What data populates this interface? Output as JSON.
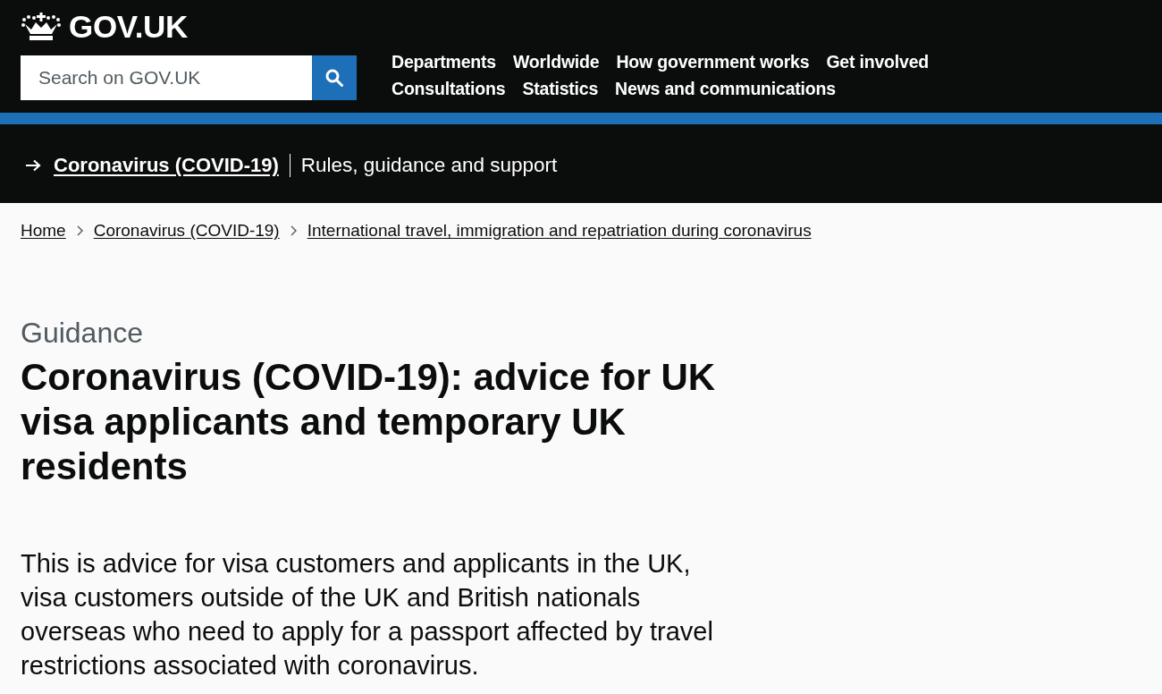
{
  "header": {
    "logo": {
      "text": "GOV.UK"
    },
    "search": {
      "placeholder": "Search on GOV.UK"
    },
    "nav": [
      "Departments",
      "Worldwide",
      "How government works",
      "Get involved",
      "Consultations",
      "Statistics",
      "News and communications"
    ]
  },
  "banner": {
    "link": "Coronavirus (COVID-19)",
    "text": "Rules, guidance and support"
  },
  "breadcrumbs": [
    "Home",
    "Coronavirus (COVID-19)",
    "International travel, immigration and repatriation during coronavirus"
  ],
  "caption": "Guidance",
  "title": "Coronavirus (COVID-19): advice for UK visa applicants and temporary UK residents",
  "lead": "This is advice for visa customers and applicants in the UK, visa customers outside of the UK and British nationals overseas who need to apply for a passport affected by travel restrictions associated with coronavirus."
}
